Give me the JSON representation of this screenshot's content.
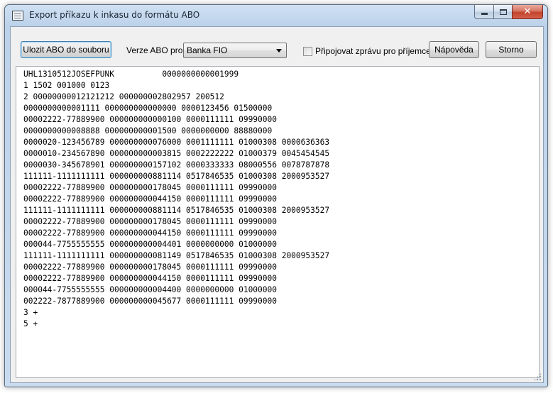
{
  "window": {
    "title": "Export příkazu k inkasu do formátu ABO",
    "caption_buttons": {
      "minimize_icon": "minimize-icon",
      "maximize_icon": "maximize-icon",
      "close_icon": "close-icon",
      "close_glyph": "✕"
    }
  },
  "toolbar": {
    "save_label": "Ulozit ABO do souboru",
    "version_label": "Verze ABO pro",
    "bank_selected": "Banka FIO",
    "attach_message_label": "Připojovat zprávu pro příjemce",
    "attach_message_checked": false,
    "help_label": "Nápověda",
    "cancel_label": "Storno"
  },
  "output": {
    "lines": [
      "UHL1310512JOSEFPUNK          0000000000001999",
      "1 1502 001000 0123",
      "2 00000000012121212 000000002802957 200512",
      "0000000000001111 000000000000000 0000123456 01500000",
      "00002222-77889900 000000000000100 0000111111 09990000",
      "0000000000008888 000000000001500 0000000000 88880000",
      "0000020-123456789 000000000076000 0001111111 01000308 0000636363",
      "0000010-234567890 000000000003815 0002222222 01000379 0045454545",
      "0000030-345678901 000000000157102 0000333333 08000556 0078787878",
      "111111-1111111111 000000000881114 0517846535 01000308 2000953527",
      "00002222-77889900 000000000178045 0000111111 09990000",
      "00002222-77889900 000000000044150 0000111111 09990000",
      "111111-1111111111 000000000881114 0517846535 01000308 2000953527",
      "00002222-77889900 000000000178045 0000111111 09990000",
      "00002222-77889900 000000000044150 0000111111 09990000",
      "000044-7755555555 000000000004401 0000000000 01000000",
      "111111-1111111111 000000000081149 0517846535 01000308 2000953527",
      "00002222-77889900 000000000178045 0000111111 09990000",
      "00002222-77889900 000000000044150 0000111111 09990000",
      "000044-7755555555 000000000004400 0000000000 01000000",
      "002222-7877889900 000000000045677 0000111111 09990000",
      "3 +",
      "5 +"
    ]
  }
}
